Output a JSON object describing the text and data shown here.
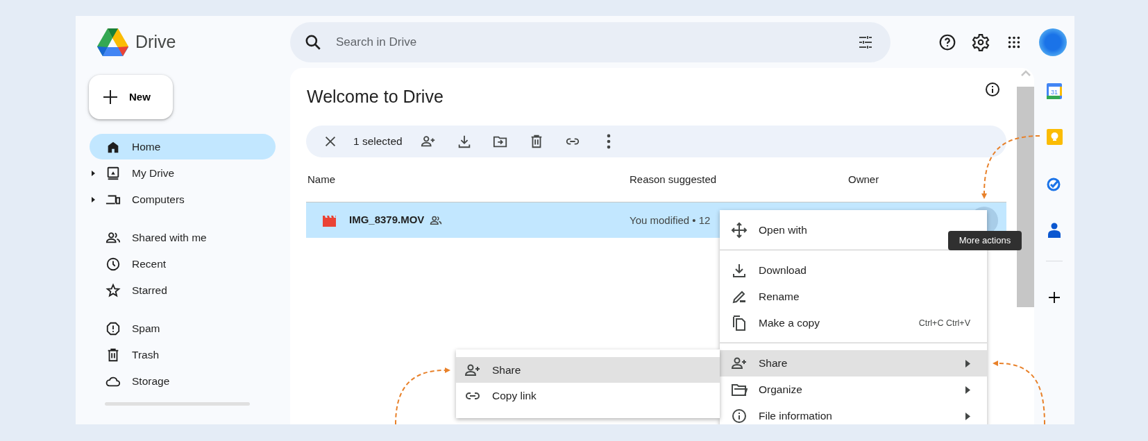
{
  "app": {
    "name": "Drive"
  },
  "new_button": {
    "label": "New"
  },
  "sidebar": {
    "sections": [
      {
        "items": [
          {
            "label": "Home",
            "selected": true,
            "expandable": false
          },
          {
            "label": "My Drive",
            "selected": false,
            "expandable": true
          },
          {
            "label": "Computers",
            "selected": false,
            "expandable": true
          }
        ]
      },
      {
        "items": [
          {
            "label": "Shared with me",
            "selected": false,
            "expandable": false
          },
          {
            "label": "Recent",
            "selected": false,
            "expandable": false
          },
          {
            "label": "Starred",
            "selected": false,
            "expandable": false
          }
        ]
      },
      {
        "items": [
          {
            "label": "Spam",
            "selected": false,
            "expandable": false
          },
          {
            "label": "Trash",
            "selected": false,
            "expandable": false
          },
          {
            "label": "Storage",
            "selected": false,
            "expandable": false
          }
        ]
      }
    ]
  },
  "search": {
    "placeholder": "Search in Drive"
  },
  "page": {
    "title": "Welcome to Drive"
  },
  "selection_bar": {
    "label": "1 selected"
  },
  "table": {
    "columns": [
      "Name",
      "Reason suggested",
      "Owner"
    ],
    "rows": [
      {
        "name": "IMG_8379.MOV",
        "shared": true,
        "reason": "You modified • 12",
        "selected": true
      }
    ]
  },
  "tooltip": "More actions",
  "context_menu": {
    "items": [
      {
        "kind": "item",
        "label": "Open with",
        "submenu": false,
        "selected": false
      },
      {
        "kind": "divider"
      },
      {
        "kind": "item",
        "label": "Download",
        "submenu": false,
        "selected": false
      },
      {
        "kind": "item",
        "label": "Rename",
        "submenu": false,
        "selected": false
      },
      {
        "kind": "item",
        "label": "Make a copy",
        "shortcut": "Ctrl+C Ctrl+V",
        "submenu": false,
        "selected": false
      },
      {
        "kind": "divider"
      },
      {
        "kind": "item",
        "label": "Share",
        "submenu": true,
        "selected": true
      },
      {
        "kind": "item",
        "label": "Organize",
        "submenu": true,
        "selected": false
      },
      {
        "kind": "item",
        "label": "File information",
        "submenu": true,
        "selected": false
      }
    ]
  },
  "submenu": {
    "items": [
      {
        "label": "Share",
        "selected": true
      },
      {
        "label": "Copy link",
        "selected": false
      }
    ]
  },
  "side_panel": {
    "calendar_day": "31"
  }
}
